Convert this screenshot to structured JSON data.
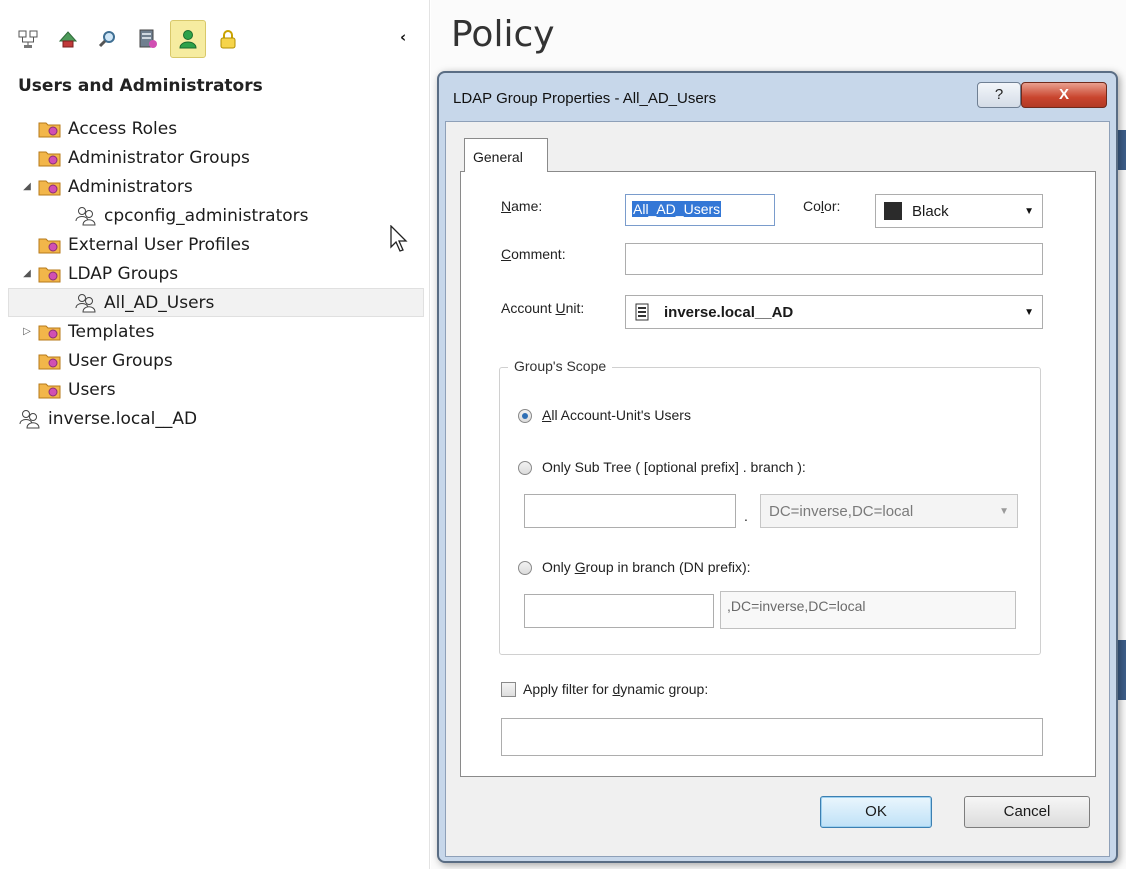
{
  "left_panel": {
    "tree_title": "Users and Administrators",
    "toolbar": [
      {
        "icon": "network-objects-icon",
        "active": false
      },
      {
        "icon": "services-icon",
        "active": false
      },
      {
        "icon": "search-icon",
        "active": false
      },
      {
        "icon": "resources-icon",
        "active": false
      },
      {
        "icon": "users-icon",
        "active": true
      },
      {
        "icon": "lock-icon",
        "active": false
      }
    ],
    "collapse_glyph": "‹",
    "tree": [
      {
        "label": "Access Roles",
        "icon": "folder-icon",
        "level": 1,
        "expander": ""
      },
      {
        "label": "Administrator Groups",
        "icon": "folder-icon",
        "level": 1,
        "expander": ""
      },
      {
        "label": "Administrators",
        "icon": "folder-icon",
        "level": 1,
        "expander": "◢"
      },
      {
        "label": "cpconfig_administrators",
        "icon": "user-group-icon",
        "level": 2,
        "expander": ""
      },
      {
        "label": "External User Profiles",
        "icon": "folder-icon",
        "level": 1,
        "expander": ""
      },
      {
        "label": "LDAP Groups",
        "icon": "folder-icon",
        "level": 1,
        "expander": "◢"
      },
      {
        "label": "All_AD_Users",
        "icon": "user-group-icon",
        "level": 2,
        "expander": "",
        "selected": true
      },
      {
        "label": "Templates",
        "icon": "folder-icon",
        "level": 1,
        "expander": "▷"
      },
      {
        "label": "User Groups",
        "icon": "folder-icon",
        "level": 1,
        "expander": ""
      },
      {
        "label": "Users",
        "icon": "folder-icon",
        "level": 1,
        "expander": ""
      },
      {
        "label": "inverse.local__AD",
        "icon": "user-group-icon",
        "level": 0,
        "expander": ""
      }
    ]
  },
  "main": {
    "title": "Policy"
  },
  "dialog": {
    "title": "LDAP Group Properties - All_AD_Users",
    "help_label": "?",
    "close_label": "X",
    "tab_general": "General",
    "name": {
      "label_u": "N",
      "label_rest": "ame:",
      "value": "All_AD_Users"
    },
    "color": {
      "label_pre": "Co",
      "label_u": "l",
      "label_post": "or:",
      "value": "Black",
      "swatch": "#2b2b2b"
    },
    "comment": {
      "label_u": "C",
      "label_rest": "omment:",
      "value": ""
    },
    "account_unit": {
      "label_pre": "Account ",
      "label_u": "U",
      "label_post": "nit:",
      "value": "inverse.local__AD",
      "icon": "server-icon"
    },
    "scope": {
      "legend": "Group's Scope",
      "all_users": {
        "u": "A",
        "rest": "ll Account-Unit's Users",
        "selected": true
      },
      "sub_tree": {
        "label": "Only Sub Tree ( [optional prefix] . branch ):",
        "selected": false,
        "prefix_value": "",
        "separator": ".",
        "branch_value": "DC=inverse,DC=local"
      },
      "group_in_branch": {
        "pre": "Only ",
        "u": "G",
        "post": "roup in branch (DN prefix):",
        "selected": false,
        "prefix_value": "",
        "suffix_value": ",DC=inverse,DC=local"
      }
    },
    "dynamic_filter": {
      "pre": "Apply filter for ",
      "u": "d",
      "post": "ynamic group:",
      "checked": false,
      "value": ""
    },
    "ok_label": "OK",
    "cancel_label": "Cancel"
  }
}
